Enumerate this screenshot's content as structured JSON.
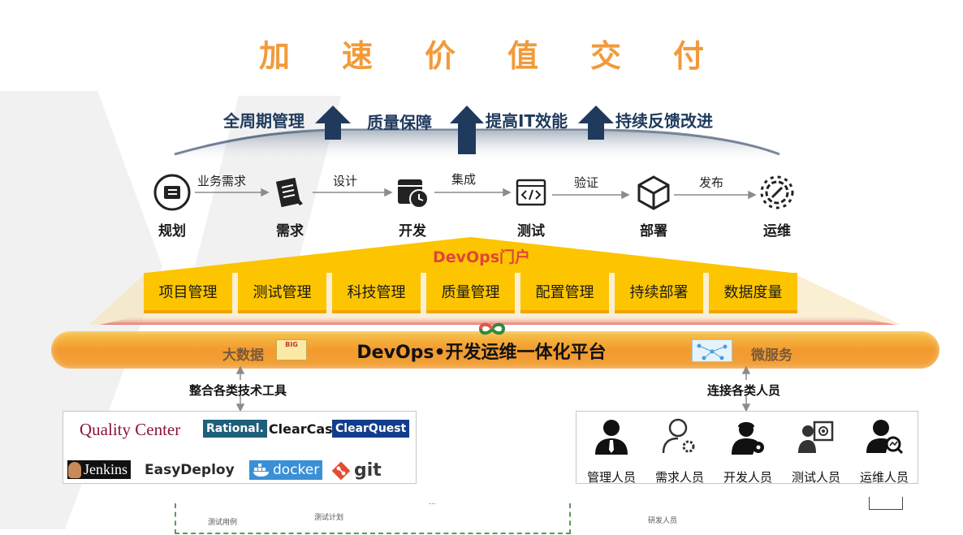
{
  "title_chars": [
    "加",
    "速",
    "价",
    "值",
    "交",
    "付"
  ],
  "goals": [
    "全周期管理",
    "质量保障",
    "提高IT效能",
    "持续反馈改进"
  ],
  "stages": [
    {
      "label": "规划",
      "icon": "plan-icon"
    },
    {
      "label": "需求",
      "icon": "requirement-icon"
    },
    {
      "label": "开发",
      "icon": "development-icon"
    },
    {
      "label": "测试",
      "icon": "test-icon"
    },
    {
      "label": "部署",
      "icon": "deploy-icon"
    },
    {
      "label": "运维",
      "icon": "operations-icon"
    }
  ],
  "flow_labels": [
    "业务需求",
    "设计",
    "集成",
    "验证",
    "发布"
  ],
  "portal_title": "DevOps门户",
  "modules": [
    "项目管理",
    "测试管理",
    "科技管理",
    "质量管理",
    "配置管理",
    "持续部署",
    "数据度量"
  ],
  "platform": {
    "title": "DevOps•开发运维一体化平台",
    "left_label": "大数据",
    "right_label": "微服务",
    "big_badge": "BIG"
  },
  "tools_title": "整合各类技术工具",
  "people_title": "连接各类人员",
  "tools": {
    "quality_center": "Quality Center",
    "rational": "Rational.",
    "clearcase": "ClearCase",
    "clearquest": "ClearQuest",
    "jenkins": "Jenkins",
    "easydeploy": "EasyDeploy",
    "docker": "docker",
    "git": "git"
  },
  "people": [
    {
      "label": "管理人员",
      "icon": "manager-icon"
    },
    {
      "label": "需求人员",
      "icon": "requirement-staff-icon"
    },
    {
      "label": "开发人员",
      "icon": "developer-icon"
    },
    {
      "label": "测试人员",
      "icon": "tester-icon"
    },
    {
      "label": "运维人员",
      "icon": "operator-icon"
    }
  ],
  "bottom_fragments": {
    "test_case": "测试用例",
    "test_plan": "测试计划",
    "dev_staff": "研发人员",
    "ellipsis": "..."
  },
  "colors": {
    "title": "#f29a3a",
    "goal_text": "#1f3a5c",
    "arrow": "#1f3a5c",
    "module": "#fcc500",
    "portal_title": "#e0453a",
    "platform": "#f29a2e"
  }
}
